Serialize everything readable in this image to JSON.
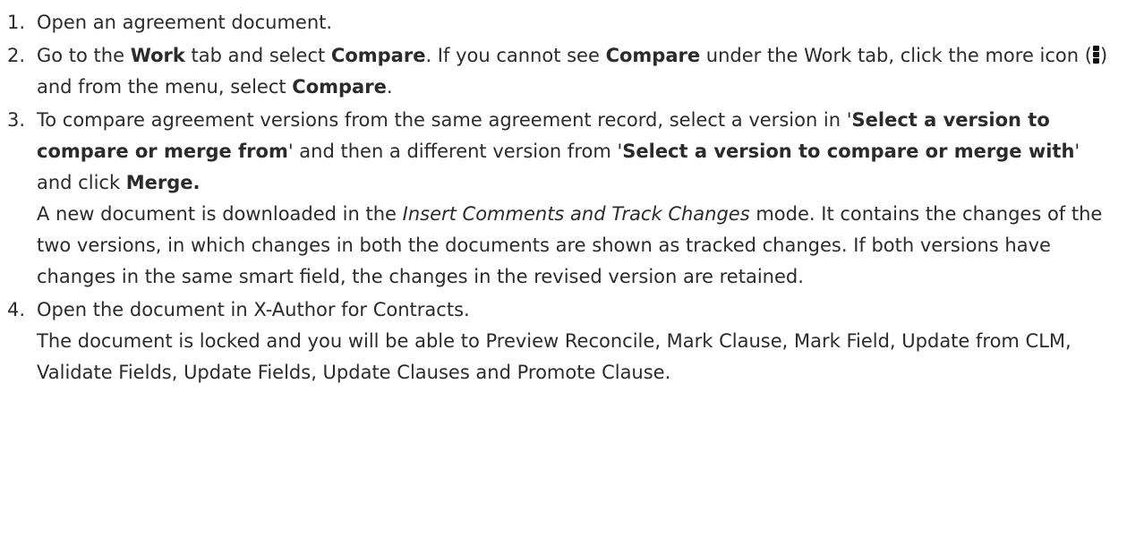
{
  "steps": [
    {
      "num": "1.",
      "text": "Open an agreement document."
    },
    {
      "num": "2.",
      "t1": "Go to the ",
      "b1": "Work",
      "t2": " tab and select ",
      "b2": "Compare",
      "t3": ". If you cannot see ",
      "b3": "Compare",
      "t4": " under the Work tab, click the more icon (",
      "icon": "more-vertical-icon",
      "t5": ") and from the menu, select ",
      "b4": "Compare",
      "t6": "."
    },
    {
      "num": "3.",
      "t1": "To compare agreement versions from the same agreement record, select a version in '",
      "b1": "Select a version to compare or merge from",
      "t2": "' and then a different version from '",
      "b2": "Select a version to compare or merge with",
      "t3": "' and click ",
      "b3": "Merge.",
      "p1": "A new document is downloaded in the ",
      "i1": "Insert Comments and Track Changes",
      "p2": " mode. It contains the changes of the two versions, in which changes in both the documents are shown as tracked changes. If both versions have changes in the same smart field, the changes in the revised version are retained."
    },
    {
      "num": "4.",
      "text": "Open the document in X-Author for Contracts.",
      "p1": "The document is locked and you will be able to Preview Reconcile, Mark Clause, Mark Field, Update from CLM, Validate Fields, Update Fields, Update Clauses and Promote Clause."
    }
  ]
}
